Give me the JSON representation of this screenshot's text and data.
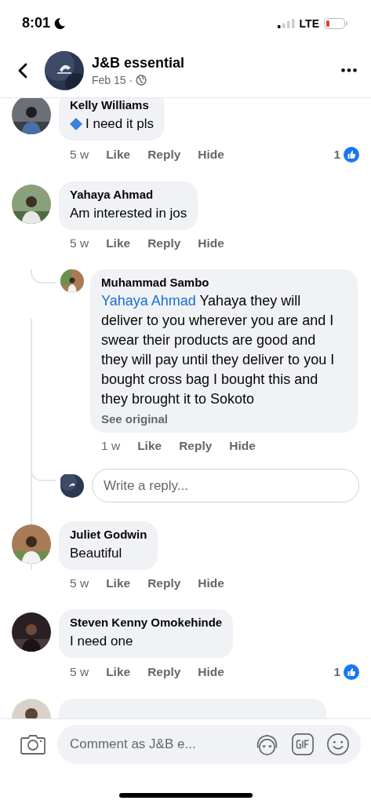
{
  "status_bar": {
    "time": "8:01",
    "network": "LTE"
  },
  "header": {
    "title": "J&B essential",
    "date": "Feb 15",
    "dot": "·",
    "avatar": {
      "kind": "picture"
    }
  },
  "comments": [
    {
      "kind": "emoji",
      "author": "Kelly Williams",
      "text": "I need it pls",
      "avatar": {
        "kind": "picture"
      },
      "actions": [
        "5 w",
        "Like",
        "Reply",
        "Hide"
      ],
      "likes": "1"
    },
    {
      "kind": "text",
      "author": "Yahaya Ahmad",
      "text": "Am interested in jos",
      "avatar": {
        "kind": "picture"
      },
      "actions": [
        "5 w",
        "Like",
        "Reply",
        "Hide"
      ],
      "children": [
        {
          "author": "Muhammad Sambo",
          "mention": "Yahaya Ahmad",
          "text": "Yahaya they will deliver to you wherever you are and I swear their products are good and they will pay until they deliver to you I bought cross bag I bought this and they brought it to Sokoto",
          "see_original": "See original",
          "avatar": {
            "kind": "picture"
          },
          "actions": [
            "1 w",
            "Like",
            "Reply",
            "Hide"
          ]
        }
      ],
      "reply_field": {
        "placeholder": "Write a reply..."
      }
    },
    {
      "kind": "text",
      "author": "Juliet Godwin",
      "text": "Beautiful",
      "avatar": {
        "kind": "picture"
      },
      "actions": [
        "5 w",
        "Like",
        "Reply",
        "Hide"
      ]
    },
    {
      "kind": "text",
      "author": "Steven Kenny Omokehinde",
      "text": "I need one",
      "avatar": {
        "kind": "picture"
      },
      "actions": [
        "5 w",
        "Like",
        "Reply",
        "Hide"
      ],
      "likes": "1"
    },
    {
      "kind": "partial",
      "avatar": {
        "kind": "picture"
      }
    }
  ],
  "composer": {
    "placeholder": "Comment as J&B e..."
  }
}
